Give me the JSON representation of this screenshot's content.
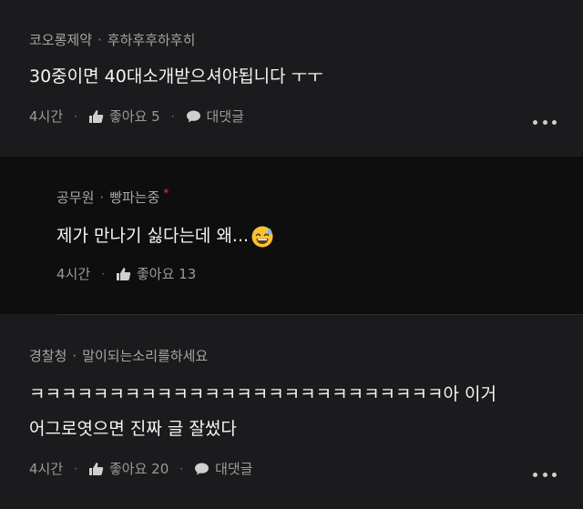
{
  "comments": [
    {
      "author": "코오롱제약",
      "nickname": "후하후후하후히",
      "text": "30중이면 40대소개받으셔야됩니다 ㅜㅜ",
      "time": "4시간",
      "like_label": "좋아요 5",
      "reply_label": "대댓글"
    },
    {
      "author": "공무원",
      "nickname": "빵파는중",
      "author_badge": "*",
      "text": "제가 만나기 싫다는데 왜...",
      "emoji": "sweat-smile-emoji",
      "time": "4시간",
      "like_label": "좋아요 13"
    },
    {
      "author": "경찰청",
      "nickname": "말이되는소리를하세요",
      "text_line1": "ㅋㅋㅋㅋㅋㅋㅋㅋㅋㅋㅋㅋㅋㅋㅋㅋㅋㅋㅋㅋㅋㅋㅋㅋㅋㅋ아 이거",
      "text_line2": "어그로엿으면 진짜 글 잘썼다",
      "time": "4시간",
      "like_label": "좋아요 20",
      "reply_label": "대댓글"
    }
  ],
  "separator_dot": "·",
  "icons": {
    "like": "thumbs-up-icon",
    "reply": "speech-bubble-icon",
    "more": "more-options-icon"
  },
  "colors": {
    "background": "#1b1b1d",
    "reply_background": "#0e0e0f",
    "badge": "#e0344a"
  }
}
